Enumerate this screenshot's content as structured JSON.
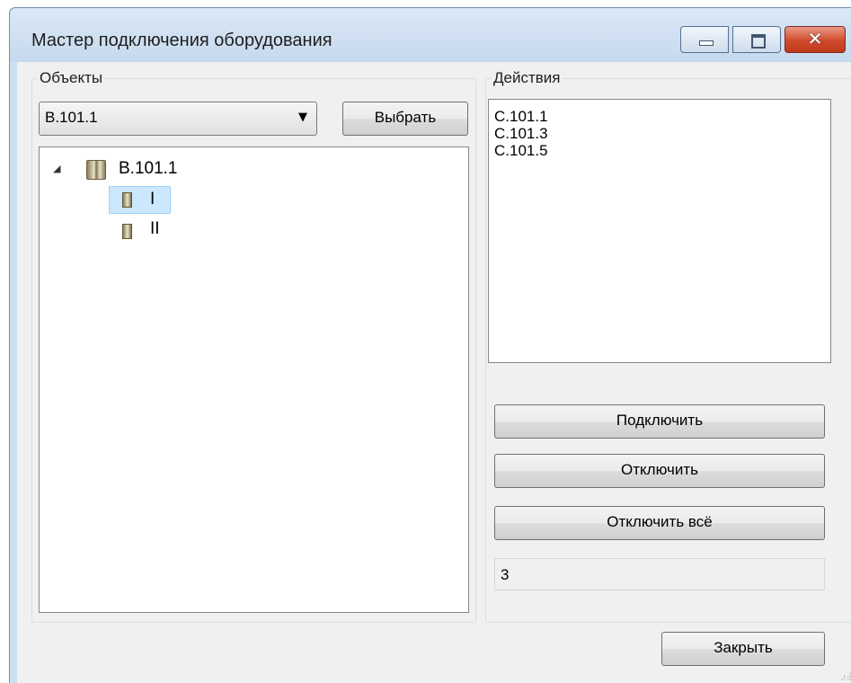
{
  "window": {
    "title": "Мастер подключения оборудования",
    "close_glyph": "✕"
  },
  "objects_group": {
    "label": "Объекты",
    "combo_value": "B.101.1",
    "select_button": "Выбрать",
    "tree": {
      "root": {
        "label": "B.101.1",
        "expanded": true,
        "icon": "cabinet-icon"
      },
      "children": [
        {
          "label": "I",
          "selected": true,
          "icon": "panel-icon"
        },
        {
          "label": "II",
          "selected": false,
          "icon": "panel-icon"
        }
      ]
    }
  },
  "actions_group": {
    "label": "Действия",
    "list_items": [
      "C.101.1",
      "C.101.3",
      "C.101.5"
    ],
    "connect_button": "Подключить",
    "disconnect_button": "Отключить",
    "disconnect_all_button": "Отключить всё",
    "count_value": "3"
  },
  "footer": {
    "close_button": "Закрыть"
  },
  "colors": {
    "selection": "#cce8ff",
    "titlebar": "#c6d9ee",
    "close_button": "#c0391b"
  }
}
